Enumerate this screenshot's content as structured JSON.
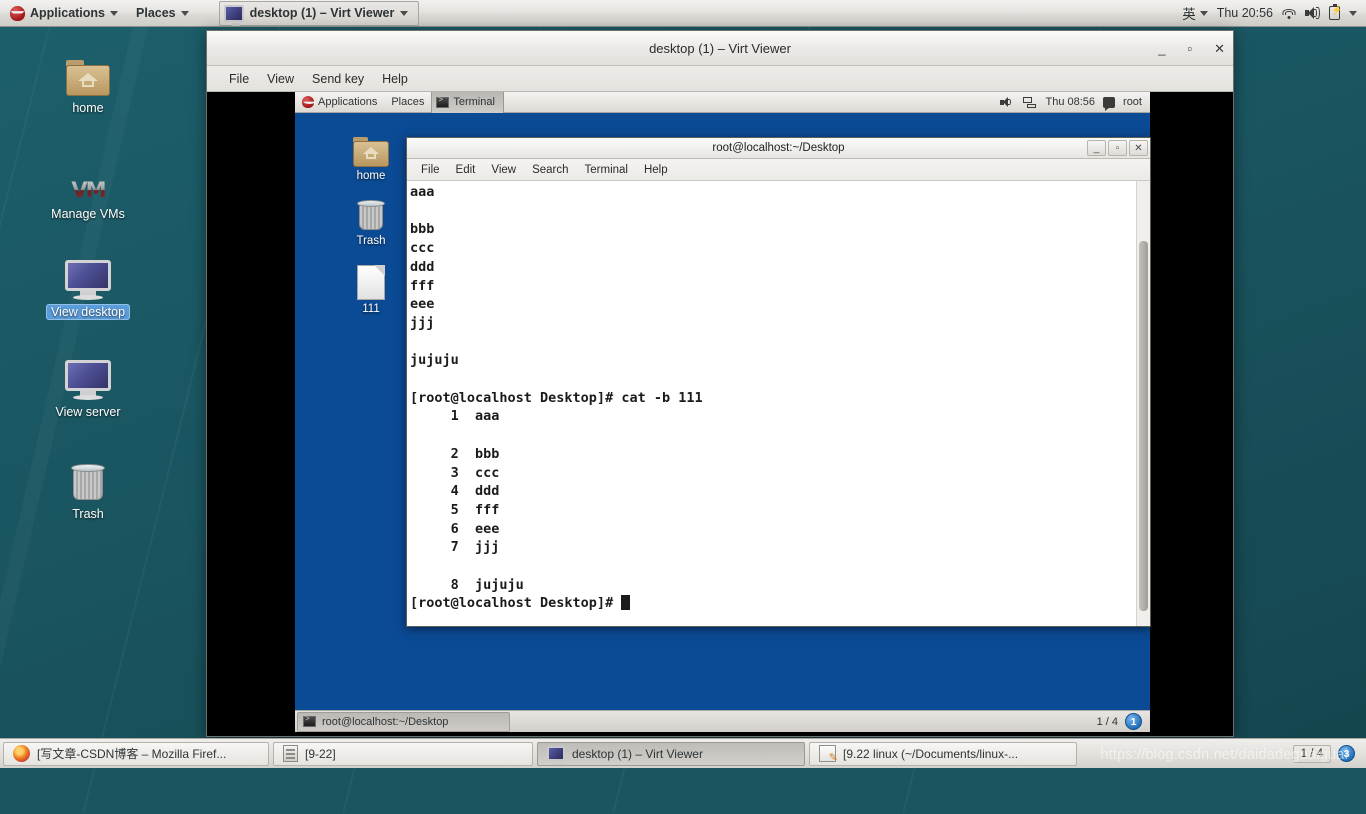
{
  "host": {
    "top_panel": {
      "applications": "Applications",
      "places": "Places",
      "window_task": "desktop (1) – Virt Viewer",
      "ime": "英",
      "clock": "Thu 20:56",
      "icons": [
        "wifi-icon",
        "volume-icon",
        "battery-icon",
        "chevron-down-icon"
      ]
    },
    "desktop_icons": [
      {
        "label": "home",
        "icon": "home-folder-icon",
        "selected": false
      },
      {
        "label": "Manage VMs",
        "icon": "vmware-logo-icon",
        "selected": false
      },
      {
        "label": "View desktop",
        "icon": "monitor-icon",
        "selected": true
      },
      {
        "label": "View server",
        "icon": "monitor-icon",
        "selected": false
      },
      {
        "label": "Trash",
        "icon": "trash-icon",
        "selected": false
      }
    ],
    "taskbar": {
      "buttons": [
        {
          "label": "[写文章-CSDN博客 – Mozilla Firef...",
          "icon": "firefox-icon",
          "active": false
        },
        {
          "label": "[9-22]",
          "icon": "archive-manager-icon",
          "active": false
        },
        {
          "label": "desktop (1) – Virt Viewer",
          "icon": "monitor-icon",
          "active": true
        },
        {
          "label": "[9.22 linux (~/Documents/linux-...",
          "icon": "text-editor-icon",
          "active": false
        }
      ],
      "workspace": "1 / 4",
      "workspace_number": "3"
    },
    "watermark": "https://blog.csdn.net/daidadeguaiguai"
  },
  "virt_viewer": {
    "title": "desktop (1) – Virt Viewer",
    "menu": [
      "File",
      "View",
      "Send key",
      "Help"
    ],
    "controls": {
      "minimize": "_",
      "maximize": "▫",
      "close": "✕"
    }
  },
  "guest": {
    "top_panel": {
      "applications": "Applications",
      "places": "Places",
      "task": "Terminal",
      "clock": "Thu 08:56",
      "user": "root"
    },
    "desktop_icons": [
      {
        "label": "home",
        "icon": "home-folder-icon"
      },
      {
        "label": "Trash",
        "icon": "trash-icon"
      },
      {
        "label": "111",
        "icon": "document-icon"
      }
    ],
    "bottom_panel": {
      "task": "root@localhost:~/Desktop",
      "workspace": "1 / 4",
      "workspace_number": "1"
    }
  },
  "terminal": {
    "title": "root@localhost:~/Desktop",
    "menu": [
      "File",
      "Edit",
      "View",
      "Search",
      "Terminal",
      "Help"
    ],
    "controls": {
      "minimize": "_",
      "maximize": "▫",
      "close": "✕"
    },
    "content": "aaa\n\nbbb\nccc\nddd\nfff\neee\njjj\n\njujuju\n\n[root@localhost Desktop]# cat -b 111\n     1\taaa\n\n     2\tbbb\n     3\tccc\n     4\tddd\n     5\tfff\n     6\teee\n     7\tjjj\n\n     8\tjujuju\n",
    "prompt": "[root@localhost Desktop]# "
  }
}
